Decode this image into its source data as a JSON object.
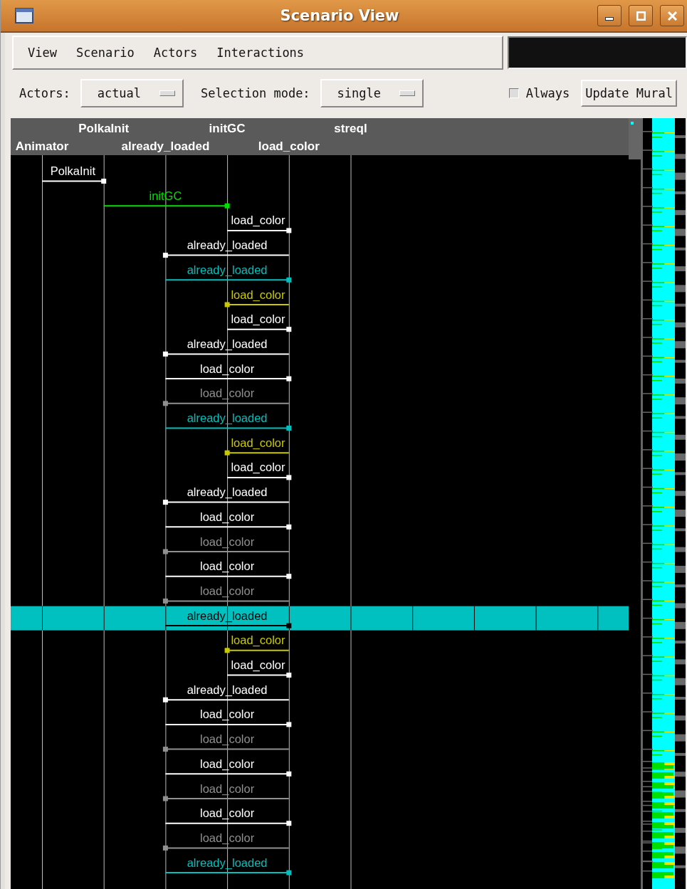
{
  "window": {
    "title": "Scenario View"
  },
  "menu": [
    {
      "label": "View"
    },
    {
      "label": "Scenario"
    },
    {
      "label": "Actors"
    },
    {
      "label": "Interactions"
    }
  ],
  "toolbar": {
    "actors": {
      "label": "Actors:",
      "value": "actual"
    },
    "selection_mode": {
      "label": "Selection mode:",
      "value": "single"
    },
    "always": {
      "label": "Always",
      "checked": false
    },
    "button": "Update Mural"
  },
  "actors": [
    {
      "name": "Animator"
    },
    {
      "name": "PolkaInit"
    },
    {
      "name": "already_loaded"
    },
    {
      "name": "initGC"
    },
    {
      "name": "load_color"
    },
    {
      "name": "streql"
    }
  ],
  "messages": [
    {
      "label": "PolkaInit",
      "kind": "ab",
      "color": "#ffffff",
      "selected": false
    },
    {
      "label": "initGC",
      "kind": "bd",
      "color": "#00e000",
      "selected": false
    },
    {
      "label": "load_color",
      "kind": "de",
      "color": "#ffffff",
      "selected": false
    },
    {
      "label": "already_loaded",
      "kind": "ec",
      "color": "#ffffff",
      "selected": false
    },
    {
      "label": "already_loaded",
      "kind": "ce",
      "color": "#00bfbf",
      "selected": false
    },
    {
      "label": "load_color",
      "kind": "ed",
      "color": "#c8c800",
      "selected": false
    },
    {
      "label": "load_color",
      "kind": "de",
      "color": "#ffffff",
      "selected": false
    },
    {
      "label": "already_loaded",
      "kind": "ec",
      "color": "#ffffff",
      "selected": false
    },
    {
      "label": "load_color",
      "kind": "ce",
      "color": "#ffffff",
      "selected": false
    },
    {
      "label": "load_color",
      "kind": "ec",
      "color": "#909090",
      "selected": false
    },
    {
      "label": "already_loaded",
      "kind": "ce",
      "color": "#00bfbf",
      "selected": false
    },
    {
      "label": "load_color",
      "kind": "ed",
      "color": "#c8c800",
      "selected": false
    },
    {
      "label": "load_color",
      "kind": "de",
      "color": "#ffffff",
      "selected": false
    },
    {
      "label": "already_loaded",
      "kind": "ec",
      "color": "#ffffff",
      "selected": false
    },
    {
      "label": "load_color",
      "kind": "ce",
      "color": "#ffffff",
      "selected": false
    },
    {
      "label": "load_color",
      "kind": "ec",
      "color": "#909090",
      "selected": false
    },
    {
      "label": "load_color",
      "kind": "ce",
      "color": "#ffffff",
      "selected": false
    },
    {
      "label": "load_color",
      "kind": "ec",
      "color": "#909090",
      "selected": false
    },
    {
      "label": "already_loaded",
      "kind": "ce",
      "color": "#000000",
      "selected": true
    },
    {
      "label": "load_color",
      "kind": "ed",
      "color": "#c8c800",
      "selected": false
    },
    {
      "label": "load_color",
      "kind": "de",
      "color": "#ffffff",
      "selected": false
    },
    {
      "label": "already_loaded",
      "kind": "ec",
      "color": "#ffffff",
      "selected": false
    },
    {
      "label": "load_color",
      "kind": "ce",
      "color": "#ffffff",
      "selected": false
    },
    {
      "label": "load_color",
      "kind": "ec",
      "color": "#909090",
      "selected": false
    },
    {
      "label": "load_color",
      "kind": "ce",
      "color": "#ffffff",
      "selected": false
    },
    {
      "label": "load_color",
      "kind": "ec",
      "color": "#909090",
      "selected": false
    },
    {
      "label": "load_color",
      "kind": "ce",
      "color": "#ffffff",
      "selected": false
    },
    {
      "label": "load_color",
      "kind": "ec",
      "color": "#909090",
      "selected": false
    },
    {
      "label": "already_loaded",
      "kind": "ce",
      "color": "#00bfbf",
      "selected": false
    }
  ]
}
